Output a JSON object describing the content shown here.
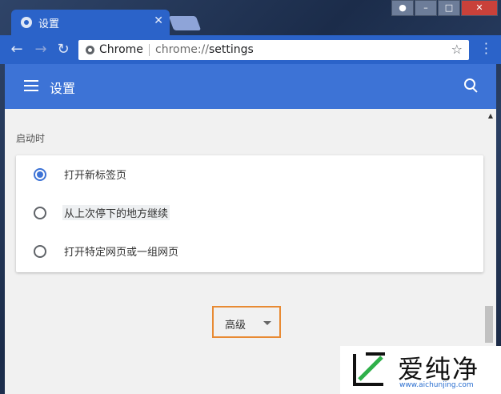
{
  "browser": {
    "tab_title": "设置",
    "omnibox_chip": "Chrome",
    "url_scheme": "chrome://",
    "url_path": "settings"
  },
  "header": {
    "title": "设置"
  },
  "startup": {
    "section_label": "启动时",
    "options": [
      {
        "label": "打开新标签页",
        "selected": true
      },
      {
        "label": "从上次停下的地方继续",
        "selected": false
      },
      {
        "label": "打开特定网页或一组网页",
        "selected": false
      }
    ]
  },
  "advanced": {
    "label": "高级"
  },
  "watermark": {
    "text": "爱纯净",
    "sub": "www.aichunjing.com"
  },
  "colors": {
    "accent": "#3d73d6",
    "highlight_border": "#e88a33"
  }
}
